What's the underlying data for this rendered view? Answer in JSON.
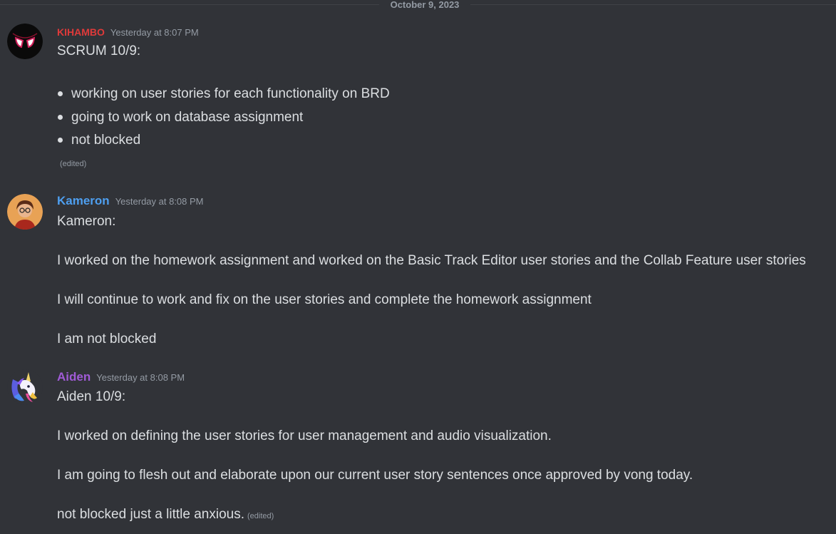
{
  "divider": {
    "date": "October 9, 2023"
  },
  "messages": [
    {
      "author": "KIHAMBO",
      "author_color": "#e03a3a",
      "timestamp": "Yesterday at 8:07 PM",
      "avatar_icon": "spider-mask-icon",
      "title": "SCRUM 10/9:",
      "bullets": [
        "working on user stories for each functionality on BRD",
        "going to work on database assignment",
        "not blocked"
      ],
      "edited": "(edited)"
    },
    {
      "author": "Kameron",
      "author_color": "#4e9ff0",
      "timestamp": "Yesterday at 8:08 PM",
      "avatar_icon": "cartoon-person-avatar-icon",
      "lines": [
        "Kameron:",
        "I worked on the homework assignment and worked on the Basic Track Editor user stories and the Collab Feature user stories",
        "I will continue to work and fix on the user stories and complete the homework assignment",
        "I am not blocked"
      ]
    },
    {
      "author": "Aiden",
      "author_color": "#a05bd6",
      "timestamp": "Yesterday at 8:08 PM",
      "avatar_icon": "unicorn-avatar-icon",
      "lines": [
        "Aiden 10/9:",
        "I worked on defining the user stories for user management and audio visualization.",
        "I am going to flesh out and elaborate upon our current user story sentences once approved by vong today.",
        "not blocked just a little anxious."
      ],
      "edited": "(edited)"
    }
  ]
}
